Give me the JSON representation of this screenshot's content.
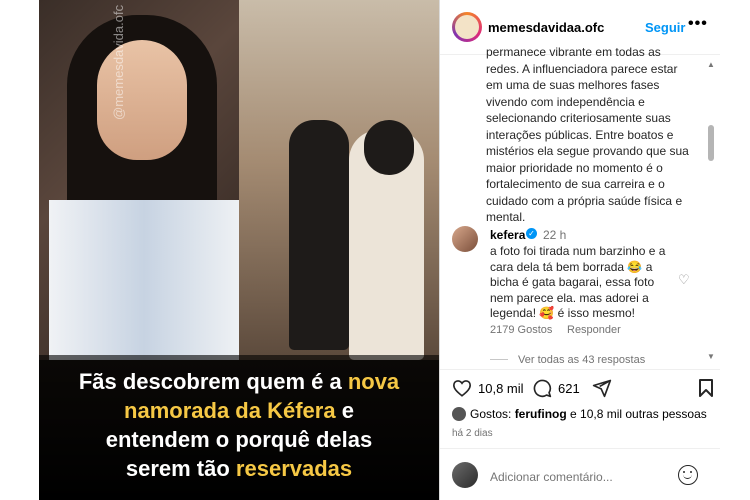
{
  "post": {
    "watermark": "@memesdavida.ofc",
    "caption_lines": [
      {
        "parts": [
          {
            "text": "Fãs descobrem quem é a ",
            "hl": false
          },
          {
            "text": "nova",
            "hl": true
          }
        ]
      },
      {
        "parts": [
          {
            "text": "namorada da Kéfera",
            "hl": true
          },
          {
            "text": " e",
            "hl": false
          }
        ]
      },
      {
        "parts": [
          {
            "text": "entendem o porquê delas",
            "hl": false
          }
        ]
      },
      {
        "parts": [
          {
            "text": "serem tão ",
            "hl": false
          },
          {
            "text": "reservadas",
            "hl": true
          }
        ]
      }
    ]
  },
  "header": {
    "username": "memesdavidaa.ofc",
    "follow_label": "Seguir",
    "more_label": "•••"
  },
  "caption_text": "permanece vibrante em todas as redes. A influenciadora parece estar em uma de suas melhores fases vivendo com independência e selecionando criteriosamente suas interações públicas. Entre boatos e mistérios ela segue provando que sua maior prioridade no momento é o fortalecimento de sua carreira e o cuidado com a própria saúde física e mental.",
  "comment": {
    "username": "kefera",
    "time": "22 h",
    "text": "a foto foi tirada num barzinho e a cara dela tá bem borrada 😂 a bicha é gata bagarai, essa foto nem parece ela. mas adorei a legenda! 🥰 é isso mesmo!",
    "likes": "2179 Gostos",
    "reply_label": "Responder",
    "view_replies": "Ver todas as 43 respostas"
  },
  "actions": {
    "likes_count": "10,8 mil",
    "comments_count": "621"
  },
  "likes_line": {
    "prefix": "Gostos: ",
    "user": "ferufinog",
    "suffix": " e 10,8 mil outras pessoas"
  },
  "date": "há 2 dias",
  "add_comment_placeholder": "Adicionar comentário..."
}
